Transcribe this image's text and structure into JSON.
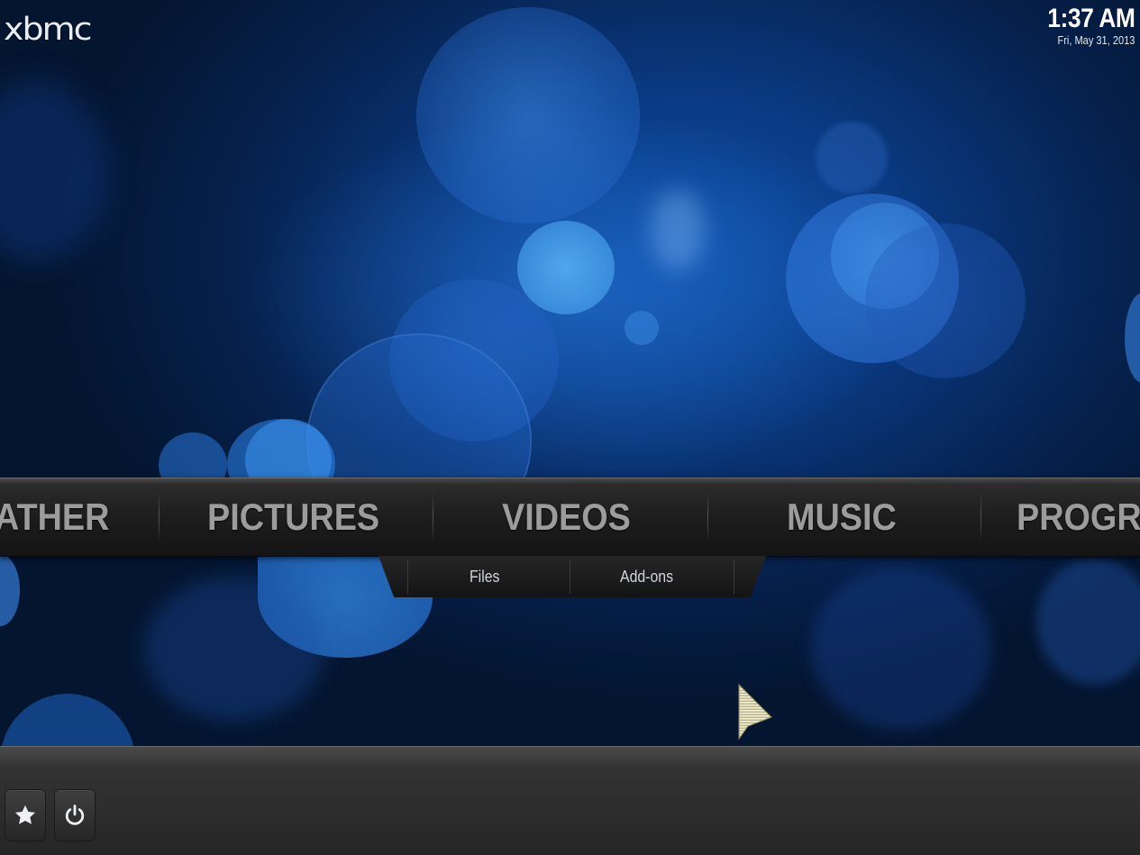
{
  "app": {
    "logo_text": "xbmc"
  },
  "clock": {
    "time": "1:37 AM",
    "date": "Fri, May 31, 2013"
  },
  "main_menu": {
    "items": [
      {
        "label": "ATHER"
      },
      {
        "label": "PICTURES"
      },
      {
        "label": "VIDEOS"
      },
      {
        "label": "MUSIC"
      },
      {
        "label": "PROGR"
      }
    ]
  },
  "submenu": {
    "items": [
      {
        "label": "Files"
      },
      {
        "label": "Add-ons"
      }
    ]
  },
  "bottom_bar": {
    "buttons": [
      {
        "icon": "star-icon"
      },
      {
        "icon": "power-icon"
      }
    ]
  },
  "colors": {
    "background": "#0a3a82",
    "menu_text": "#9c9c9c",
    "submenu_text": "#d0d4da"
  }
}
